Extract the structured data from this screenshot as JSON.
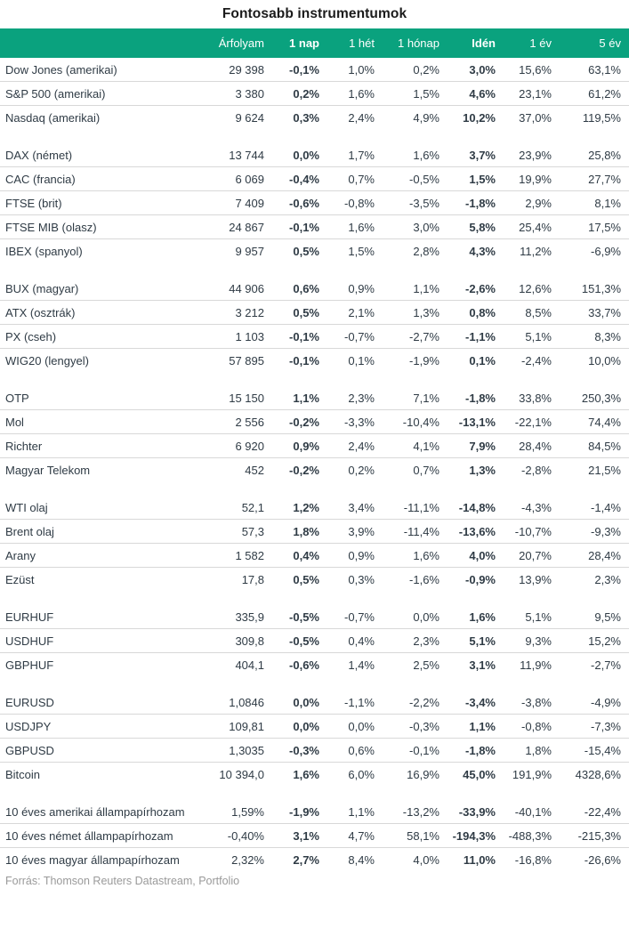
{
  "title": "Fontosabb instrumentumok",
  "source_note": "Forrás: Thomson Reuters Datastream, Portfolio",
  "accent_color": "#0aa27e",
  "text_color": "#2f3b45",
  "columns": [
    {
      "key": "name",
      "label": "",
      "bold": false
    },
    {
      "key": "price",
      "label": "Árfolyam",
      "bold": false
    },
    {
      "key": "d1",
      "label": "1 nap",
      "bold": true
    },
    {
      "key": "w1",
      "label": "1 hét",
      "bold": false
    },
    {
      "key": "m1",
      "label": "1 hónap",
      "bold": false
    },
    {
      "key": "ytd",
      "label": "Idén",
      "bold": true
    },
    {
      "key": "y1",
      "label": "1 év",
      "bold": false
    },
    {
      "key": "y5",
      "label": "5 év",
      "bold": false
    }
  ],
  "groups": [
    {
      "id": "us-indices",
      "rows": [
        {
          "name": "Dow Jones (amerikai)",
          "price": "29 398",
          "d1": "-0,1%",
          "w1": "1,0%",
          "m1": "0,2%",
          "ytd": "3,0%",
          "y1": "15,6%",
          "y5": "63,1%"
        },
        {
          "name": "S&P 500 (amerikai)",
          "price": "3 380",
          "d1": "0,2%",
          "w1": "1,6%",
          "m1": "1,5%",
          "ytd": "4,6%",
          "y1": "23,1%",
          "y5": "61,2%"
        },
        {
          "name": "Nasdaq (amerikai)",
          "price": "9 624",
          "d1": "0,3%",
          "w1": "2,4%",
          "m1": "4,9%",
          "ytd": "10,2%",
          "y1": "37,0%",
          "y5": "119,5%"
        }
      ]
    },
    {
      "id": "west-europe-indices",
      "rows": [
        {
          "name": "DAX (német)",
          "price": "13 744",
          "d1": "0,0%",
          "w1": "1,7%",
          "m1": "1,6%",
          "ytd": "3,7%",
          "y1": "23,9%",
          "y5": "25,8%"
        },
        {
          "name": "CAC (francia)",
          "price": "6 069",
          "d1": "-0,4%",
          "w1": "0,7%",
          "m1": "-0,5%",
          "ytd": "1,5%",
          "y1": "19,9%",
          "y5": "27,7%"
        },
        {
          "name": "FTSE (brit)",
          "price": "7 409",
          "d1": "-0,6%",
          "w1": "-0,8%",
          "m1": "-3,5%",
          "ytd": "-1,8%",
          "y1": "2,9%",
          "y5": "8,1%"
        },
        {
          "name": "FTSE MIB (olasz)",
          "price": "24 867",
          "d1": "-0,1%",
          "w1": "1,6%",
          "m1": "3,0%",
          "ytd": "5,8%",
          "y1": "25,4%",
          "y5": "17,5%"
        },
        {
          "name": "IBEX (spanyol)",
          "price": "9 957",
          "d1": "0,5%",
          "w1": "1,5%",
          "m1": "2,8%",
          "ytd": "4,3%",
          "y1": "11,2%",
          "y5": "-6,9%"
        }
      ]
    },
    {
      "id": "cee-indices",
      "rows": [
        {
          "name": "BUX (magyar)",
          "price": "44 906",
          "d1": "0,6%",
          "w1": "0,9%",
          "m1": "1,1%",
          "ytd": "-2,6%",
          "y1": "12,6%",
          "y5": "151,3%"
        },
        {
          "name": "ATX (osztrák)",
          "price": "3 212",
          "d1": "0,5%",
          "w1": "2,1%",
          "m1": "1,3%",
          "ytd": "0,8%",
          "y1": "8,5%",
          "y5": "33,7%"
        },
        {
          "name": "PX (cseh)",
          "price": "1 103",
          "d1": "-0,1%",
          "w1": "-0,7%",
          "m1": "-2,7%",
          "ytd": "-1,1%",
          "y1": "5,1%",
          "y5": "8,3%"
        },
        {
          "name": "WIG20 (lengyel)",
          "price": "57 895",
          "d1": "-0,1%",
          "w1": "0,1%",
          "m1": "-1,9%",
          "ytd": "0,1%",
          "y1": "-2,4%",
          "y5": "10,0%"
        }
      ]
    },
    {
      "id": "hungarian-stocks",
      "rows": [
        {
          "name": "OTP",
          "price": "15 150",
          "d1": "1,1%",
          "w1": "2,3%",
          "m1": "7,1%",
          "ytd": "-1,8%",
          "y1": "33,8%",
          "y5": "250,3%"
        },
        {
          "name": "Mol",
          "price": "2 556",
          "d1": "-0,2%",
          "w1": "-3,3%",
          "m1": "-10,4%",
          "ytd": "-13,1%",
          "y1": "-22,1%",
          "y5": "74,4%"
        },
        {
          "name": "Richter",
          "price": "6 920",
          "d1": "0,9%",
          "w1": "2,4%",
          "m1": "4,1%",
          "ytd": "7,9%",
          "y1": "28,4%",
          "y5": "84,5%"
        },
        {
          "name": "Magyar Telekom",
          "price": "452",
          "d1": "-0,2%",
          "w1": "0,2%",
          "m1": "0,7%",
          "ytd": "1,3%",
          "y1": "-2,8%",
          "y5": "21,5%"
        }
      ]
    },
    {
      "id": "commodities",
      "rows": [
        {
          "name": "WTI olaj",
          "price": "52,1",
          "d1": "1,2%",
          "w1": "3,4%",
          "m1": "-11,1%",
          "ytd": "-14,8%",
          "y1": "-4,3%",
          "y5": "-1,4%"
        },
        {
          "name": "Brent olaj",
          "price": "57,3",
          "d1": "1,8%",
          "w1": "3,9%",
          "m1": "-11,4%",
          "ytd": "-13,6%",
          "y1": "-10,7%",
          "y5": "-9,3%"
        },
        {
          "name": "Arany",
          "price": "1 582",
          "d1": "0,4%",
          "w1": "0,9%",
          "m1": "1,6%",
          "ytd": "4,0%",
          "y1": "20,7%",
          "y5": "28,4%"
        },
        {
          "name": "Ezüst",
          "price": "17,8",
          "d1": "0,5%",
          "w1": "0,3%",
          "m1": "-1,6%",
          "ytd": "-0,9%",
          "y1": "13,9%",
          "y5": "2,3%"
        }
      ]
    },
    {
      "id": "huf-crosses",
      "rows": [
        {
          "name": "EURHUF",
          "price": "335,9",
          "d1": "-0,5%",
          "w1": "-0,7%",
          "m1": "0,0%",
          "ytd": "1,6%",
          "y1": "5,1%",
          "y5": "9,5%"
        },
        {
          "name": "USDHUF",
          "price": "309,8",
          "d1": "-0,5%",
          "w1": "0,4%",
          "m1": "2,3%",
          "ytd": "5,1%",
          "y1": "9,3%",
          "y5": "15,2%"
        },
        {
          "name": "GBPHUF",
          "price": "404,1",
          "d1": "-0,6%",
          "w1": "1,4%",
          "m1": "2,5%",
          "ytd": "3,1%",
          "y1": "11,9%",
          "y5": "-2,7%"
        }
      ]
    },
    {
      "id": "major-fx-crypto",
      "rows": [
        {
          "name": "EURUSD",
          "price": "1,0846",
          "d1": "0,0%",
          "w1": "-1,1%",
          "m1": "-2,2%",
          "ytd": "-3,4%",
          "y1": "-3,8%",
          "y5": "-4,9%"
        },
        {
          "name": "USDJPY",
          "price": "109,81",
          "d1": "0,0%",
          "w1": "0,0%",
          "m1": "-0,3%",
          "ytd": "1,1%",
          "y1": "-0,8%",
          "y5": "-7,3%"
        },
        {
          "name": "GBPUSD",
          "price": "1,3035",
          "d1": "-0,3%",
          "w1": "0,6%",
          "m1": "-0,1%",
          "ytd": "-1,8%",
          "y1": "1,8%",
          "y5": "-15,4%"
        },
        {
          "name": "Bitcoin",
          "price": "10 394,0",
          "d1": "1,6%",
          "w1": "6,0%",
          "m1": "16,9%",
          "ytd": "45,0%",
          "y1": "191,9%",
          "y5": "4328,6%"
        }
      ]
    },
    {
      "id": "bond-yields",
      "rows": [
        {
          "name": "10 éves amerikai állampapírhozam",
          "price": "1,59%",
          "d1": "-1,9%",
          "w1": "1,1%",
          "m1": "-13,2%",
          "ytd": "-33,9%",
          "y1": "-40,1%",
          "y5": "-22,4%"
        },
        {
          "name": "10 éves német állampapírhozam",
          "price": "-0,40%",
          "d1": "3,1%",
          "w1": "4,7%",
          "m1": "58,1%",
          "ytd": "-194,3%",
          "y1": "-488,3%",
          "y5": "-215,3%"
        },
        {
          "name": "10 éves magyar állampapírhozam",
          "price": "2,32%",
          "d1": "2,7%",
          "w1": "8,4%",
          "m1": "4,0%",
          "ytd": "11,0%",
          "y1": "-16,8%",
          "y5": "-26,6%"
        }
      ]
    }
  ]
}
